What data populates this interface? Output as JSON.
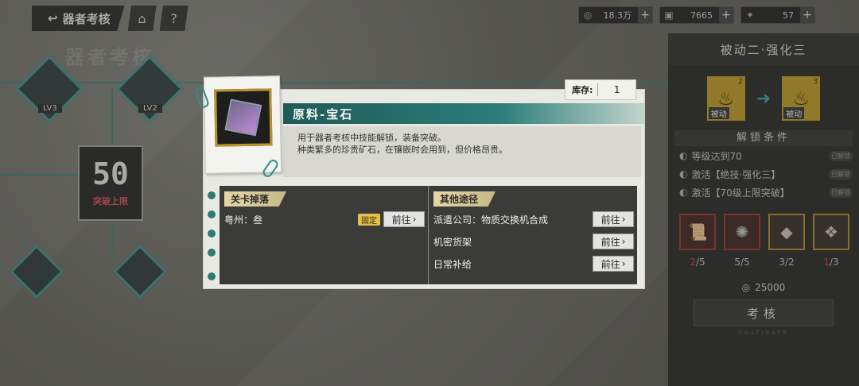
{
  "nav": {
    "back_label": "器者考核",
    "home_icon": "home-icon",
    "help_label": "?",
    "bg_title": "器者考核"
  },
  "currencies": [
    {
      "icon": "coin-icon",
      "value": "18.3万"
    },
    {
      "icon": "card-icon",
      "value": "7665"
    },
    {
      "icon": "badge-icon",
      "value": "57"
    }
  ],
  "map": {
    "nodes": [
      {
        "label": "LV3"
      },
      {
        "label": "LV2"
      }
    ],
    "stage_number": "50",
    "stage_sub": "突破上限"
  },
  "panel": {
    "title": "被动二·强化三",
    "skill_from": {
      "level": "2",
      "caption": "被动"
    },
    "skill_to": {
      "level": "3",
      "caption": "被动"
    },
    "conditions_title": "解锁条件",
    "conditions": [
      {
        "text": "等级达到70",
        "badge": "已解锁"
      },
      {
        "text": "激活【绝技·强化三】",
        "badge": "已解锁"
      },
      {
        "text": "激活【70级上限突破】",
        "badge": "已解锁"
      }
    ],
    "materials": [
      {
        "have": "2",
        "need": "/5",
        "short": true
      },
      {
        "have": "5",
        "need": "/5",
        "short": false
      },
      {
        "have": "3",
        "need": "/2",
        "short": false
      },
      {
        "have": "1",
        "need": "/3",
        "short": true
      }
    ],
    "cost": "25000",
    "assess_label": "考核",
    "footer": "CULTIVATE"
  },
  "popup": {
    "item_name": "原料-宝石",
    "description_1": "用于器者考核中技能解锁，装备突破。",
    "description_2": "种类繁多的珍贵矿石，在镶嵌时会用到，但价格昂贵。",
    "stock_label": "库存:",
    "stock_value": "1",
    "drops_title": "关卡掉落",
    "drops": [
      {
        "text": "粤州：叁",
        "tag": "固定",
        "go": "前往"
      }
    ],
    "other_title": "其他途径",
    "others": [
      {
        "text": "派遣公司：物质交换机合成",
        "go": "前往"
      },
      {
        "text": "机密货架",
        "go": "前往"
      },
      {
        "text": "日常补给",
        "go": "前往"
      }
    ]
  }
}
